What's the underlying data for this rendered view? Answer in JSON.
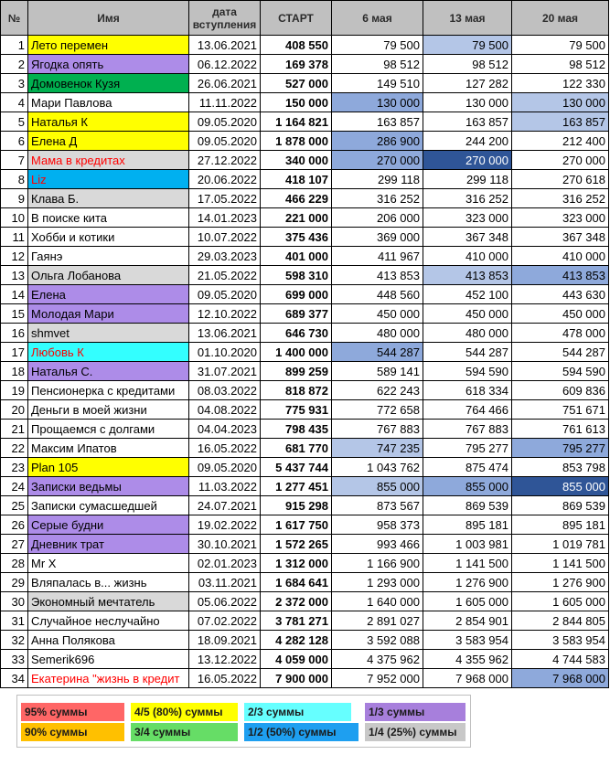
{
  "header": {
    "num": "№",
    "name": "Имя",
    "date_line1": "дата",
    "date_line2": "вступления",
    "start": "СТАРТ",
    "col_may6": "6 мая",
    "col_may13": "13 мая",
    "col_may20": "20 мая"
  },
  "colors": {
    "yellow": "#ffff00",
    "purple": "#ad8ce8",
    "green": "#00b050",
    "grey": "#d9d9d9",
    "cyan": "#33ffff",
    "blue": "#00b0f0",
    "blue_light": "#b4c6e7",
    "blue_mid": "#8ea9db",
    "blue_dark": "#2f5597",
    "red_text": "#ff0000"
  },
  "rows": [
    {
      "n": "1",
      "name": "Лето перемен",
      "date": "13.06.2021",
      "start": "408 550",
      "m6": "79 500",
      "m13": "79 500",
      "m20": "79 500",
      "name_bg": "yellow",
      "m13_bg": "blue_light"
    },
    {
      "n": "2",
      "name": "Ягодка опять",
      "date": "06.12.2022",
      "start": "169 378",
      "m6": "98 512",
      "m13": "98 512",
      "m20": "98 512",
      "name_bg": "purple"
    },
    {
      "n": "3",
      "name": "Домовенок Кузя",
      "date": "26.06.2021",
      "start": "527 000",
      "m6": "149 510",
      "m13": "127 282",
      "m20": "122 330",
      "name_bg": "green"
    },
    {
      "n": "4",
      "name": "Мари Павлова",
      "date": "11.11.2022",
      "start": "150 000",
      "m6": "130 000",
      "m13": "130 000",
      "m20": "130 000",
      "m6_bg": "blue_mid",
      "m20_bg": "blue_light"
    },
    {
      "n": "5",
      "name": "Наталья К",
      "date": "09.05.2020",
      "start": "1 164 821",
      "m6": "163 857",
      "m13": "163 857",
      "m20": "163 857",
      "name_bg": "yellow",
      "m20_bg": "blue_light"
    },
    {
      "n": "6",
      "name": "Елена Д",
      "date": "09.05.2020",
      "start": "1 878 000",
      "m6": "286 900",
      "m13": "244 200",
      "m20": "212 400",
      "name_bg": "yellow",
      "m6_bg": "blue_mid"
    },
    {
      "n": "7",
      "name": "Мама в кредитах",
      "date": "27.12.2022",
      "start": "340 000",
      "m6": "270 000",
      "m13": "270 000",
      "m20": "270 000",
      "name_bg": "grey",
      "name_color": "red_text",
      "m6_bg": "blue_mid",
      "m13_bg": "blue_dark",
      "m13_color": "#ffffff"
    },
    {
      "n": "8",
      "name": "Liz",
      "date": "20.06.2022",
      "start": "418 107",
      "m6": "299 118",
      "m13": "299 118",
      "m20": "270 618",
      "name_bg": "blue",
      "name_color": "red_text"
    },
    {
      "n": "9",
      "name": "Клава Б.",
      "date": "17.05.2022",
      "start": "466 229",
      "m6": "316 252",
      "m13": "316 252",
      "m20": "316 252",
      "name_bg": "grey"
    },
    {
      "n": "10",
      "name": "В поиске кита",
      "date": "14.01.2023",
      "start": "221 000",
      "m6": "206 000",
      "m13": "323 000",
      "m20": "323 000"
    },
    {
      "n": "11",
      "name": "Хобби и котики",
      "date": "10.07.2022",
      "start": "375 436",
      "m6": "369 000",
      "m13": "367 348",
      "m20": "367 348"
    },
    {
      "n": "12",
      "name": "Гаянэ",
      "date": "29.03.2023",
      "start": "401 000",
      "m6": "411 967",
      "m13": "410 000",
      "m20": "410 000"
    },
    {
      "n": "13",
      "name": "Ольга Лобанова",
      "date": "21.05.2022",
      "start": "598 310",
      "m6": "413 853",
      "m13": "413 853",
      "m20": "413 853",
      "name_bg": "grey",
      "m13_bg": "blue_light",
      "m20_bg": "blue_mid"
    },
    {
      "n": "14",
      "name": "Елена",
      "date": "09.05.2020",
      "start": "699 000",
      "m6": "448 560",
      "m13": "452 100",
      "m20": "443 630",
      "name_bg": "purple"
    },
    {
      "n": "15",
      "name": "Молодая Мари",
      "date": "12.10.2022",
      "start": "689 377",
      "m6": "450 000",
      "m13": "450 000",
      "m20": "450 000",
      "name_bg": "purple"
    },
    {
      "n": "16",
      "name": "shmvet",
      "date": "13.06.2021",
      "start": "646 730",
      "m6": "480 000",
      "m13": "480 000",
      "m20": "478 000",
      "name_bg": "grey"
    },
    {
      "n": "17",
      "name": "Любовь К",
      "date": "01.10.2020",
      "start": "1 400 000",
      "m6": "544 287",
      "m13": "544 287",
      "m20": "544 287",
      "name_bg": "cyan",
      "name_color": "red_text",
      "m6_bg": "blue_mid"
    },
    {
      "n": "18",
      "name": "Наталья С.",
      "date": "31.07.2021",
      "start": "899 259",
      "m6": "589 141",
      "m13": "594 590",
      "m20": "594 590",
      "name_bg": "purple"
    },
    {
      "n": "19",
      "name": "Пенсионерка с кредитами",
      "date": "08.03.2022",
      "start": "818 872",
      "m6": "622 243",
      "m13": "618 334",
      "m20": "609 836"
    },
    {
      "n": "20",
      "name": "Деньги в моей жизни",
      "date": "04.08.2022",
      "start": "775 931",
      "m6": "772 658",
      "m13": "764 466",
      "m20": "751 671"
    },
    {
      "n": "21",
      "name": "Прощаемся с долгами",
      "date": "04.04.2023",
      "start": "798 435",
      "m6": "767 883",
      "m13": "767 883",
      "m20": "761 613"
    },
    {
      "n": "22",
      "name": "Максим Ипатов",
      "date": "16.05.2022",
      "start": "681 770",
      "m6": "747 235",
      "m13": "795 277",
      "m20": "795 277",
      "m6_bg": "blue_light",
      "m20_bg": "blue_mid"
    },
    {
      "n": "23",
      "name": "Plan 105",
      "date": "09.05.2020",
      "start": "5 437 744",
      "m6": "1 043 762",
      "m13": "875 474",
      "m20": "853 798",
      "name_bg": "yellow"
    },
    {
      "n": "24",
      "name": "Записки ведьмы",
      "date": "11.03.2022",
      "start": "1 277 451",
      "m6": "855 000",
      "m13": "855 000",
      "m20": "855 000",
      "name_bg": "purple",
      "m6_bg": "blue_light",
      "m13_bg": "blue_mid",
      "m20_bg": "blue_dark",
      "m20_color": "#ffffff"
    },
    {
      "n": "25",
      "name": "Записки сумасшедшей",
      "date": "24.07.2021",
      "start": "915 298",
      "m6": "873 567",
      "m13": "869 539",
      "m20": "869 539"
    },
    {
      "n": "26",
      "name": "Серые будни",
      "date": "19.02.2022",
      "start": "1 617 750",
      "m6": "958 373",
      "m13": "895 181",
      "m20": "895 181",
      "name_bg": "purple"
    },
    {
      "n": "27",
      "name": "Дневник трат",
      "date": "30.10.2021",
      "start": "1 572 265",
      "m6": "993 466",
      "m13": "1 003 981",
      "m20": "1 019 781",
      "name_bg": "purple"
    },
    {
      "n": "28",
      "name": "Mr X",
      "date": "02.01.2023",
      "start": "1 312 000",
      "m6": "1 166 900",
      "m13": "1 141 500",
      "m20": "1 141 500"
    },
    {
      "n": "29",
      "name": "Вляпалась в... жизнь",
      "date": "03.11.2021",
      "start": "1 684 641",
      "m6": "1 293 000",
      "m13": "1 276 900",
      "m20": "1 276 900"
    },
    {
      "n": "30",
      "name": "Экономный мечтатель",
      "date": "05.06.2022",
      "start": "2 372 000",
      "m6": "1 640 000",
      "m13": "1 605 000",
      "m20": "1 605 000",
      "name_bg": "grey"
    },
    {
      "n": "31",
      "name": "Случайное неслучайно",
      "date": "07.02.2022",
      "start": "3 781 271",
      "m6": "2 891 027",
      "m13": "2 854 901",
      "m20": "2 844 805"
    },
    {
      "n": "32",
      "name": "Анна Полякова",
      "date": "18.09.2021",
      "start": "4 282 128",
      "m6": "3 592 088",
      "m13": "3 583 954",
      "m20": "3 583 954"
    },
    {
      "n": "33",
      "name": "Semerik696",
      "date": "13.12.2022",
      "start": "4 059 000",
      "m6": "4 375 962",
      "m13": "4 355 962",
      "m20": "4 744 583"
    },
    {
      "n": "34",
      "name": "Екатерина \"жизнь в кредит",
      "date": "16.05.2022",
      "start": "7 900 000",
      "m6": "7 952 000",
      "m13": "7 968 000",
      "m20": "7 968 000",
      "name_color": "red_text",
      "m20_bg": "blue_mid"
    }
  ],
  "legend": [
    {
      "label": "95% суммы",
      "bg": "#ff6666"
    },
    {
      "label": "4/5 (80%) суммы",
      "bg": "#ffff00"
    },
    {
      "label": "2/3 суммы",
      "bg": "#66ffff"
    },
    {
      "label": "1/3 суммы",
      "bg": "#a77fdc"
    },
    {
      "label": "90% суммы",
      "bg": "#ffc000"
    },
    {
      "label": "3/4 суммы",
      "bg": "#66dd66"
    },
    {
      "label": "1/2 (50%) суммы",
      "bg": "#1e9ff0"
    },
    {
      "label": "1/4 (25%) суммы",
      "bg": "#c8c8c8"
    }
  ]
}
